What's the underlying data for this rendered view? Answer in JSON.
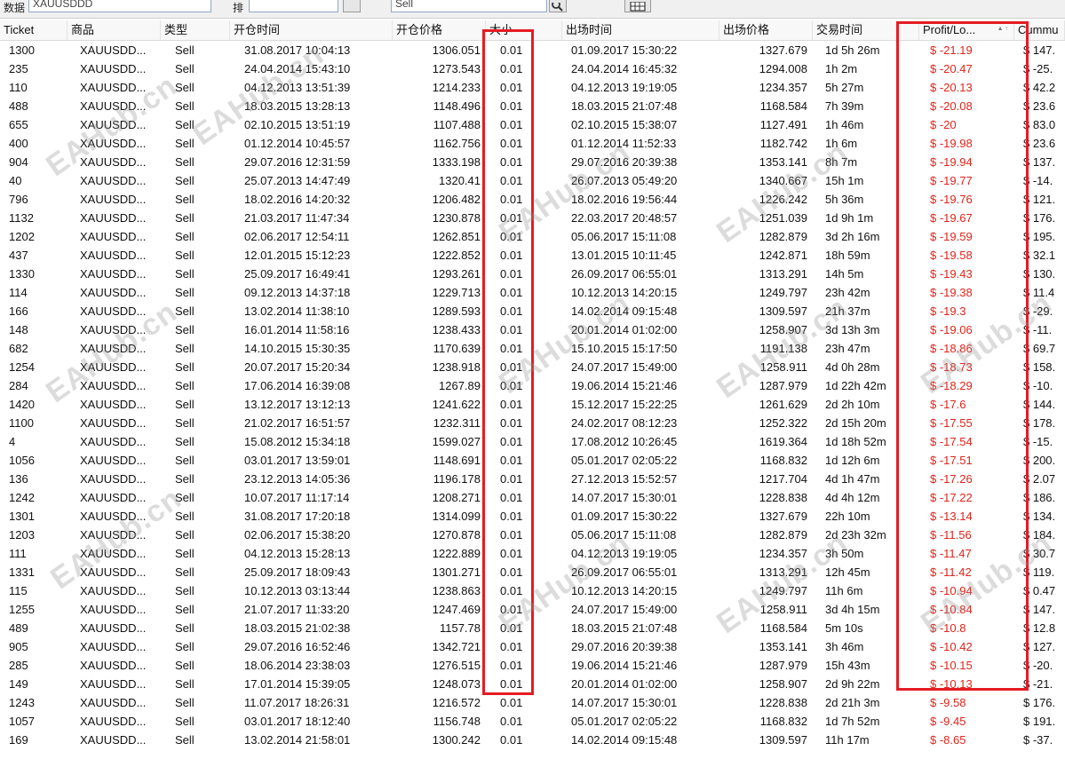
{
  "toolbar": {
    "field1_label": "数据",
    "field1_value": "XAUUSDDD",
    "field2_label": "排",
    "field2_value": "",
    "field3_value": "Sell"
  },
  "columns": [
    {
      "label": "Ticket"
    },
    {
      "label": "商品"
    },
    {
      "label": "类型"
    },
    {
      "label": "开仓时间"
    },
    {
      "label": "开仓价格"
    },
    {
      "label": "大小"
    },
    {
      "label": "出场时间"
    },
    {
      "label": "出场价格"
    },
    {
      "label": "交易时间"
    },
    {
      "label": "Profit/Lo..."
    },
    {
      "label": "Cummu"
    }
  ],
  "rows": [
    [
      "1300",
      "XAUUSDD...",
      "Sell",
      "31.08.2017 10:04:13",
      "1306.051",
      "0.01",
      "01.09.2017 15:30:22",
      "1327.679",
      "1d 5h 26m",
      "$ -21.19",
      "$ 147."
    ],
    [
      "235",
      "XAUUSDD...",
      "Sell",
      "24.04.2014 15:43:10",
      "1273.543",
      "0.01",
      "24.04.2014 16:45:32",
      "1294.008",
      "1h 2m",
      "$ -20.47",
      "$ -25."
    ],
    [
      "110",
      "XAUUSDD...",
      "Sell",
      "04.12.2013 13:51:39",
      "1214.233",
      "0.01",
      "04.12.2013 19:19:05",
      "1234.357",
      "5h 27m",
      "$ -20.13",
      "$ 42.2"
    ],
    [
      "488",
      "XAUUSDD...",
      "Sell",
      "18.03.2015 13:28:13",
      "1148.496",
      "0.01",
      "18.03.2015 21:07:48",
      "1168.584",
      "7h 39m",
      "$ -20.08",
      "$ 23.6"
    ],
    [
      "655",
      "XAUUSDD...",
      "Sell",
      "02.10.2015 13:51:19",
      "1107.488",
      "0.01",
      "02.10.2015 15:38:07",
      "1127.491",
      "1h 46m",
      "$ -20",
      "$ 83.0"
    ],
    [
      "400",
      "XAUUSDD...",
      "Sell",
      "01.12.2014 10:45:57",
      "1162.756",
      "0.01",
      "01.12.2014 11:52:33",
      "1182.742",
      "1h 6m",
      "$ -19.98",
      "$ 23.6"
    ],
    [
      "904",
      "XAUUSDD...",
      "Sell",
      "29.07.2016 12:31:59",
      "1333.198",
      "0.01",
      "29.07.2016 20:39:38",
      "1353.141",
      "8h 7m",
      "$ -19.94",
      "$ 137."
    ],
    [
      "40",
      "XAUUSDD...",
      "Sell",
      "25.07.2013 14:47:49",
      "1320.41",
      "0.01",
      "26.07.2013 05:49:20",
      "1340.667",
      "15h 1m",
      "$ -19.77",
      "$ -14."
    ],
    [
      "796",
      "XAUUSDD...",
      "Sell",
      "18.02.2016 14:20:32",
      "1206.482",
      "0.01",
      "18.02.2016 19:56:44",
      "1226.242",
      "5h 36m",
      "$ -19.76",
      "$ 121."
    ],
    [
      "1132",
      "XAUUSDD...",
      "Sell",
      "21.03.2017 11:47:34",
      "1230.878",
      "0.01",
      "22.03.2017 20:48:57",
      "1251.039",
      "1d 9h 1m",
      "$ -19.67",
      "$ 176."
    ],
    [
      "1202",
      "XAUUSDD...",
      "Sell",
      "02.06.2017 12:54:11",
      "1262.851",
      "0.01",
      "05.06.2017 15:11:08",
      "1282.879",
      "3d 2h 16m",
      "$ -19.59",
      "$ 195."
    ],
    [
      "437",
      "XAUUSDD...",
      "Sell",
      "12.01.2015 15:12:23",
      "1222.852",
      "0.01",
      "13.01.2015 10:11:45",
      "1242.871",
      "18h 59m",
      "$ -19.58",
      "$ 32.1"
    ],
    [
      "1330",
      "XAUUSDD...",
      "Sell",
      "25.09.2017 16:49:41",
      "1293.261",
      "0.01",
      "26.09.2017 06:55:01",
      "1313.291",
      "14h 5m",
      "$ -19.43",
      "$ 130."
    ],
    [
      "114",
      "XAUUSDD...",
      "Sell",
      "09.12.2013 14:37:18",
      "1229.713",
      "0.01",
      "10.12.2013 14:20:15",
      "1249.797",
      "23h 42m",
      "$ -19.38",
      "$ 11.4"
    ],
    [
      "166",
      "XAUUSDD...",
      "Sell",
      "13.02.2014 11:38:10",
      "1289.593",
      "0.01",
      "14.02.2014 09:15:48",
      "1309.597",
      "21h 37m",
      "$ -19.3",
      "$ -29."
    ],
    [
      "148",
      "XAUUSDD...",
      "Sell",
      "16.01.2014 11:58:16",
      "1238.433",
      "0.01",
      "20.01.2014 01:02:00",
      "1258.907",
      "3d 13h 3m",
      "$ -19.06",
      "$ -11."
    ],
    [
      "682",
      "XAUUSDD...",
      "Sell",
      "14.10.2015 15:30:35",
      "1170.639",
      "0.01",
      "15.10.2015 15:17:50",
      "1191.138",
      "23h 47m",
      "$ -18.86",
      "$ 69.7"
    ],
    [
      "1254",
      "XAUUSDD...",
      "Sell",
      "20.07.2017 15:20:34",
      "1238.918",
      "0.01",
      "24.07.2017 15:49:00",
      "1258.911",
      "4d 0h 28m",
      "$ -18.73",
      "$ 158."
    ],
    [
      "284",
      "XAUUSDD...",
      "Sell",
      "17.06.2014 16:39:08",
      "1267.89",
      "0.01",
      "19.06.2014 15:21:46",
      "1287.979",
      "1d 22h 42m",
      "$ -18.29",
      "$ -10."
    ],
    [
      "1420",
      "XAUUSDD...",
      "Sell",
      "13.12.2017 13:12:13",
      "1241.622",
      "0.01",
      "15.12.2017 15:22:25",
      "1261.629",
      "2d 2h 10m",
      "$ -17.6",
      "$ 144."
    ],
    [
      "1100",
      "XAUUSDD...",
      "Sell",
      "21.02.2017 16:51:57",
      "1232.311",
      "0.01",
      "24.02.2017 08:12:23",
      "1252.322",
      "2d 15h 20m",
      "$ -17.55",
      "$ 178."
    ],
    [
      "4",
      "XAUUSDD...",
      "Sell",
      "15.08.2012 15:34:18",
      "1599.027",
      "0.01",
      "17.08.2012 10:26:45",
      "1619.364",
      "1d 18h 52m",
      "$ -17.54",
      "$ -15."
    ],
    [
      "1056",
      "XAUUSDD...",
      "Sell",
      "03.01.2017 13:59:01",
      "1148.691",
      "0.01",
      "05.01.2017 02:05:22",
      "1168.832",
      "1d 12h 6m",
      "$ -17.51",
      "$ 200."
    ],
    [
      "136",
      "XAUUSDD...",
      "Sell",
      "23.12.2013 14:05:36",
      "1196.178",
      "0.01",
      "27.12.2013 15:52:57",
      "1217.704",
      "4d 1h 47m",
      "$ -17.26",
      "$ 2.07"
    ],
    [
      "1242",
      "XAUUSDD...",
      "Sell",
      "10.07.2017 11:17:14",
      "1208.271",
      "0.01",
      "14.07.2017 15:30:01",
      "1228.838",
      "4d 4h 12m",
      "$ -17.22",
      "$ 186."
    ],
    [
      "1301",
      "XAUUSDD...",
      "Sell",
      "31.08.2017 17:20:18",
      "1314.099",
      "0.01",
      "01.09.2017 15:30:22",
      "1327.679",
      "22h 10m",
      "$ -13.14",
      "$ 134."
    ],
    [
      "1203",
      "XAUUSDD...",
      "Sell",
      "02.06.2017 15:38:20",
      "1270.878",
      "0.01",
      "05.06.2017 15:11:08",
      "1282.879",
      "2d 23h 32m",
      "$ -11.56",
      "$ 184."
    ],
    [
      "111",
      "XAUUSDD...",
      "Sell",
      "04.12.2013 15:28:13",
      "1222.889",
      "0.01",
      "04.12.2013 19:19:05",
      "1234.357",
      "3h 50m",
      "$ -11.47",
      "$ 30.7"
    ],
    [
      "1331",
      "XAUUSDD...",
      "Sell",
      "25.09.2017 18:09:43",
      "1301.271",
      "0.01",
      "26.09.2017 06:55:01",
      "1313.291",
      "12h 45m",
      "$ -11.42",
      "$ 119."
    ],
    [
      "115",
      "XAUUSDD...",
      "Sell",
      "10.12.2013 03:13:44",
      "1238.863",
      "0.01",
      "10.12.2013 14:20:15",
      "1249.797",
      "11h 6m",
      "$ -10.94",
      "$ 0.47"
    ],
    [
      "1255",
      "XAUUSDD...",
      "Sell",
      "21.07.2017 11:33:20",
      "1247.469",
      "0.01",
      "24.07.2017 15:49:00",
      "1258.911",
      "3d 4h 15m",
      "$ -10.84",
      "$ 147."
    ],
    [
      "489",
      "XAUUSDD...",
      "Sell",
      "18.03.2015 21:02:38",
      "1157.78",
      "0.01",
      "18.03.2015 21:07:48",
      "1168.584",
      "5m 10s",
      "$ -10.8",
      "$ 12.8"
    ],
    [
      "905",
      "XAUUSDD...",
      "Sell",
      "29.07.2016 16:52:46",
      "1342.721",
      "0.01",
      "29.07.2016 20:39:38",
      "1353.141",
      "3h 46m",
      "$ -10.42",
      "$ 127."
    ],
    [
      "285",
      "XAUUSDD...",
      "Sell",
      "18.06.2014 23:38:03",
      "1276.515",
      "0.01",
      "19.06.2014 15:21:46",
      "1287.979",
      "15h 43m",
      "$ -10.15",
      "$ -20."
    ],
    [
      "149",
      "XAUUSDD...",
      "Sell",
      "17.01.2014 15:39:05",
      "1248.073",
      "0.01",
      "20.01.2014 01:02:00",
      "1258.907",
      "2d 9h 22m",
      "$ -10.13",
      "$ -21."
    ],
    [
      "1243",
      "XAUUSDD...",
      "Sell",
      "11.07.2017 18:26:31",
      "1216.572",
      "0.01",
      "14.07.2017 15:30:01",
      "1228.838",
      "2d 21h 3m",
      "$ -9.58",
      "$ 176."
    ],
    [
      "1057",
      "XAUUSDD...",
      "Sell",
      "03.01.2017 18:12:40",
      "1156.748",
      "0.01",
      "05.01.2017 02:05:22",
      "1168.832",
      "1d 7h 52m",
      "$ -9.45",
      "$ 191."
    ],
    [
      "169",
      "XAUUSDD...",
      "Sell",
      "13.02.2014 21:58:01",
      "1300.242",
      "0.01",
      "14.02.2014 09:15:48",
      "1309.597",
      "11h 17m",
      "$ -8.65",
      "$ -37."
    ]
  ],
  "watermark": {
    "text": "EAHub.cn"
  },
  "colors": {
    "profit_negative": "#e0241b",
    "highlight_box": "#e51c23"
  }
}
